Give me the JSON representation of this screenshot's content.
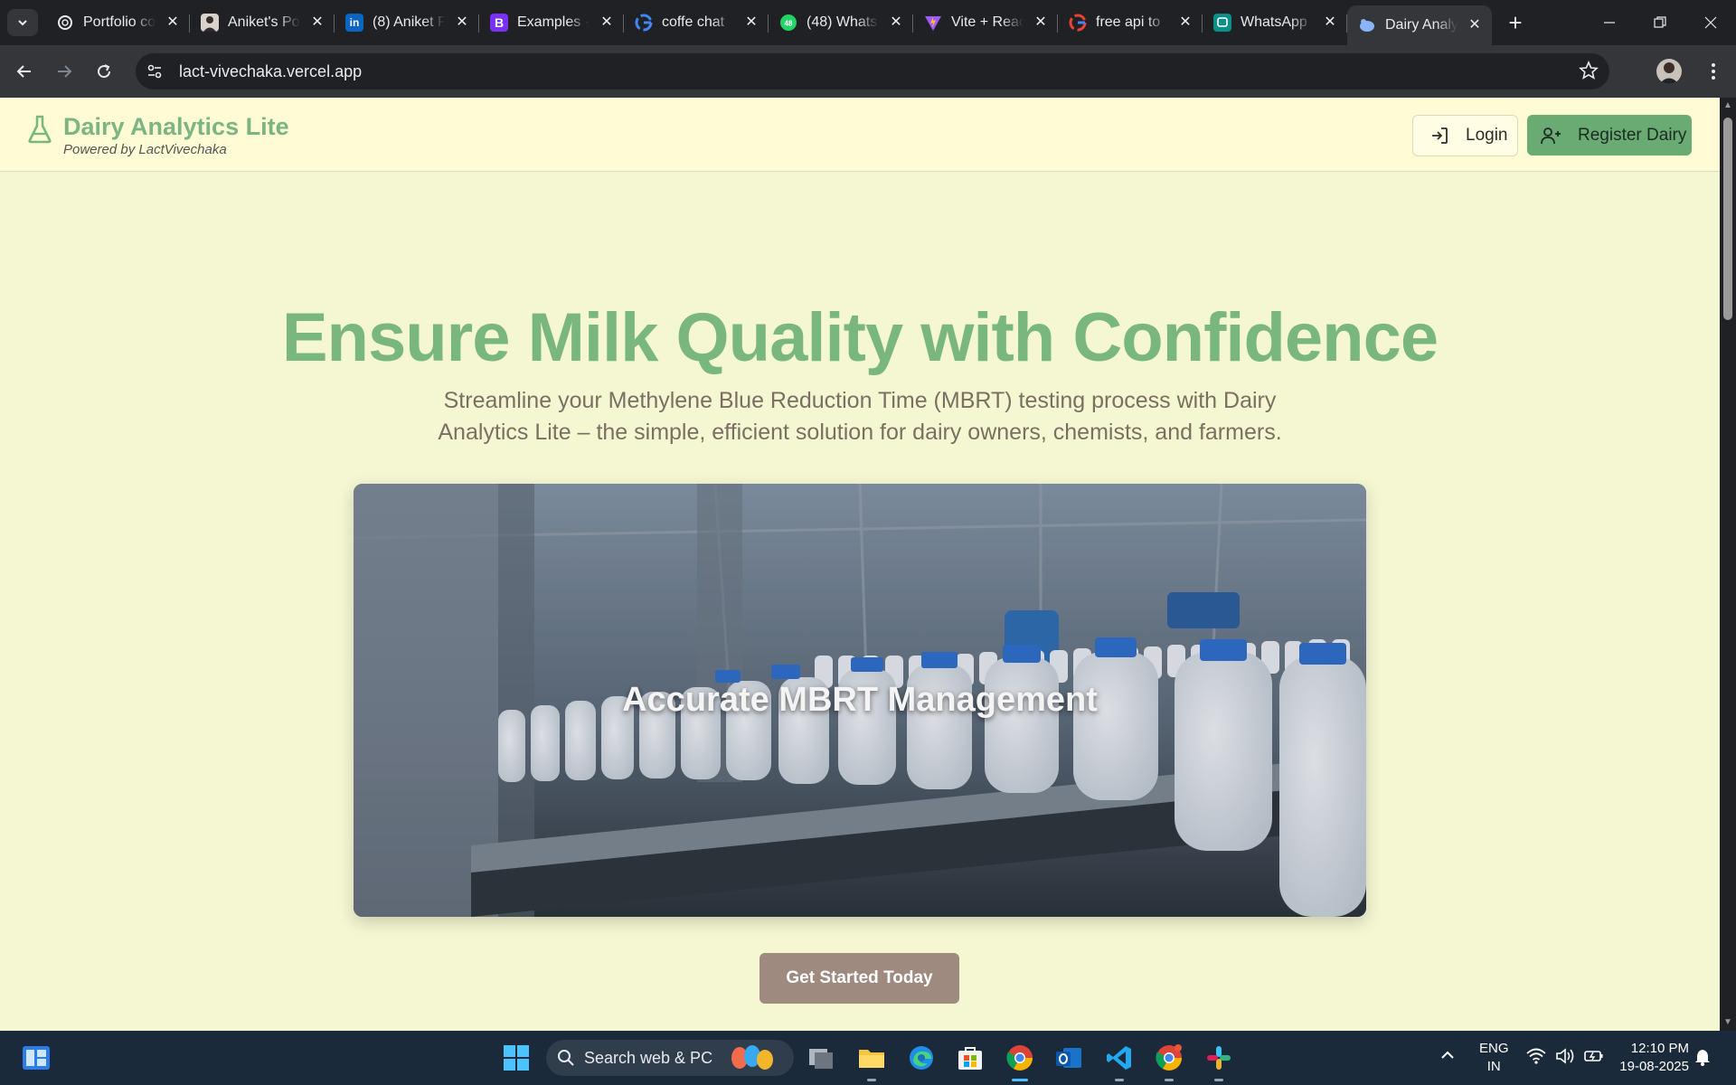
{
  "browser": {
    "tabs": [
      {
        "title": "Portfolio co",
        "icon": "openai-icon"
      },
      {
        "title": "Aniket's Po",
        "icon": "profile-photo-icon"
      },
      {
        "title": "(8) Aniket P",
        "icon": "linkedin-icon"
      },
      {
        "title": "Examples ·",
        "icon": "bootstrap-icon"
      },
      {
        "title": "coffe chat",
        "icon": "google-icon"
      },
      {
        "title": "(48) Whats",
        "icon": "whatsapp-icon"
      },
      {
        "title": "Vite + Reac",
        "icon": "vite-icon"
      },
      {
        "title": "free api to",
        "icon": "google-icon"
      },
      {
        "title": "WhatsApp",
        "icon": "whatsapp-business-icon"
      },
      {
        "title": "Dairy Analy",
        "icon": "dairy-icon",
        "active": true
      }
    ],
    "url": "lact-vivechaka.vercel.app"
  },
  "header": {
    "brand_name": "Dairy Analytics Lite",
    "brand_sub": "Powered by LactVivechaka",
    "login_label": "Login",
    "register_label": "Register Dairy"
  },
  "hero": {
    "title": "Ensure Milk Quality with Confidence",
    "subtitle": "Streamline your Methylene Blue Reduction Time (MBRT) testing process with Dairy Analytics Lite – the simple, efficient solution for dairy owners, chemists, and farmers.",
    "image_caption": "Accurate MBRT Management",
    "cta_label": "Get Started Today"
  },
  "taskbar": {
    "search_placeholder": "Search web & PC",
    "lang_top": "ENG",
    "lang_bottom": "IN",
    "time": "12:10 PM",
    "date": "19-08-2025"
  },
  "colors": {
    "brand_green": "#79b77f",
    "header_bg": "#fffcd5",
    "page_bg": "#f5f7d3",
    "register_bg": "#6aab74",
    "cta_bg": "#9f8a7f"
  }
}
